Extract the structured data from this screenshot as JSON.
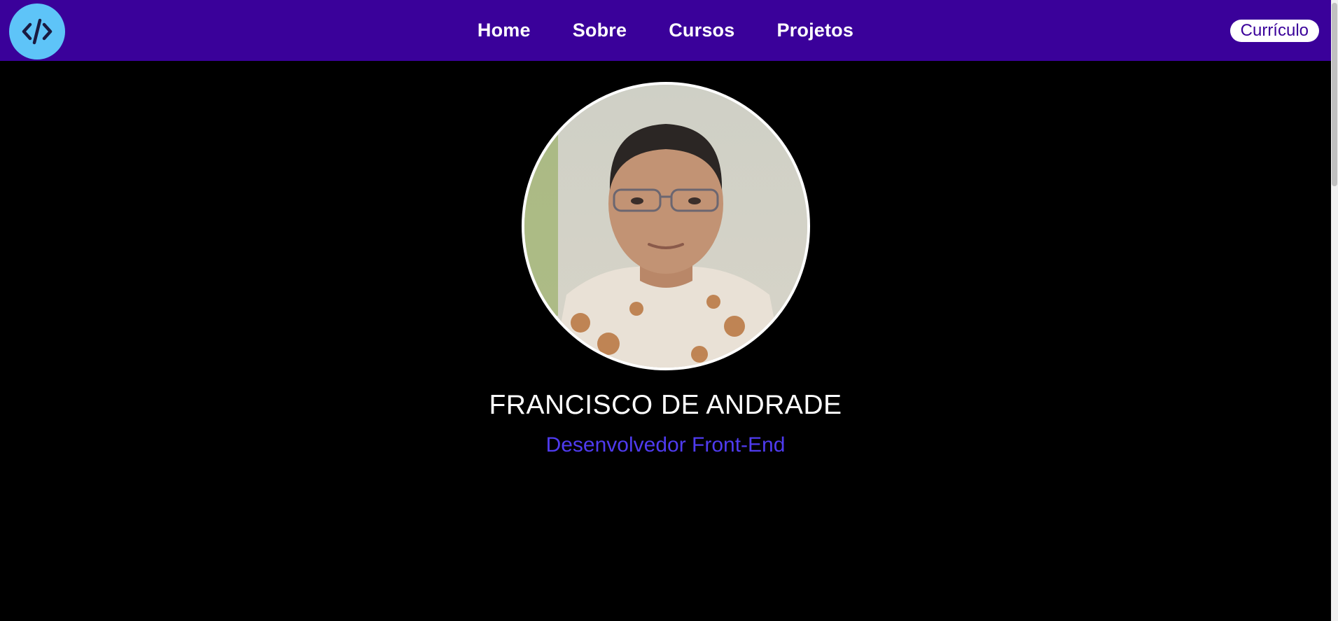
{
  "nav": {
    "logo_icon": "code-icon",
    "links": [
      "Home",
      "Sobre",
      "Cursos",
      "Projetos"
    ],
    "cv_label": "Currículo"
  },
  "hero": {
    "name": "FRANCISCO DE ANDRADE",
    "role": "Desenvolvedor Front-End",
    "photo": "profile-photo"
  },
  "colors": {
    "nav_bg": "#3a019a",
    "logo_bg": "#5ec4f8",
    "accent": "#4f3bf0",
    "page_bg": "#000000"
  }
}
